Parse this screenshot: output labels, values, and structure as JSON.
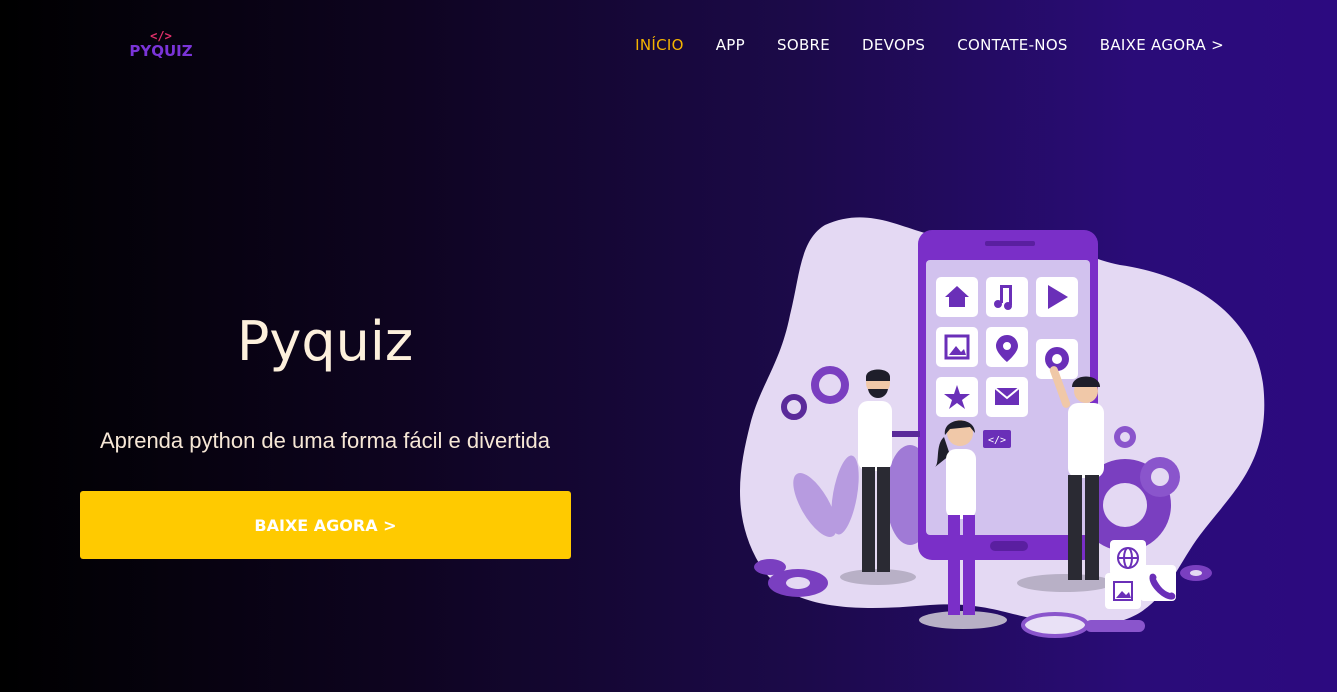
{
  "brand": {
    "mark": "</>",
    "name": "PYQUIZ"
  },
  "nav": {
    "items": [
      {
        "label": "INÍCIO",
        "active": true
      },
      {
        "label": "APP",
        "active": false
      },
      {
        "label": "SOBRE",
        "active": false
      },
      {
        "label": "DEVOPS",
        "active": false
      },
      {
        "label": "CONTATE-NOS",
        "active": false
      },
      {
        "label": "BAIXE AGORA >",
        "active": false
      }
    ]
  },
  "hero": {
    "title": "Pyquiz",
    "subtitle": "Aprenda python de uma forma fácil e divertida",
    "cta_label": "BAIXE AGORA >",
    "code_badge": "</>"
  },
  "colors": {
    "accent": "#ffca00",
    "nav_active": "#f5b400",
    "brand_purple": "#7a34d8",
    "background_end": "#2c0a80"
  },
  "illustration_icons": [
    "home-icon",
    "music-icon",
    "play-icon",
    "image-icon",
    "location-pin-icon",
    "gear-icon",
    "star-icon",
    "mail-icon",
    "code-icon",
    "globe-icon",
    "phone-icon",
    "magnifier-icon"
  ]
}
